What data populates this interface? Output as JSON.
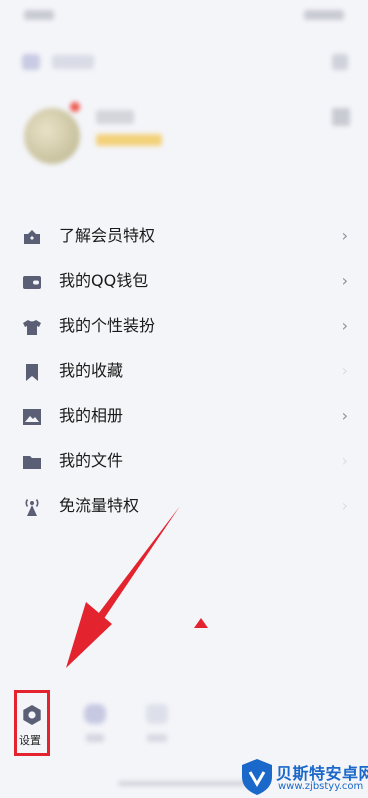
{
  "menu": {
    "items": [
      {
        "label": "了解会员特权",
        "icon": "crown-icon"
      },
      {
        "label": "我的QQ钱包",
        "icon": "wallet-icon"
      },
      {
        "label": "我的个性装扮",
        "icon": "shirt-icon"
      },
      {
        "label": "我的收藏",
        "icon": "bookmark-icon"
      },
      {
        "label": "我的相册",
        "icon": "photo-icon"
      },
      {
        "label": "我的文件",
        "icon": "folder-icon"
      },
      {
        "label": "免流量特权",
        "icon": "signal-tower-icon"
      }
    ]
  },
  "bottom": {
    "settings_label": "设置"
  },
  "watermark": {
    "title": "贝斯特安卓网",
    "url": "www.zjbstyy.com"
  },
  "colors": {
    "icon": "#5b5f76",
    "highlight": "#e3232e",
    "watermark": "#1a68c9"
  }
}
